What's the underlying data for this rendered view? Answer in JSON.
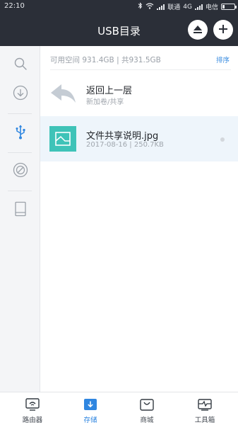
{
  "statusbar": {
    "time": "22:10",
    "carrier1": "联通",
    "network": "4G",
    "carrier2": "电信",
    "icons": [
      "bluetooth-icon",
      "wifi-icon",
      "signal-icon",
      "battery-icon"
    ]
  },
  "header": {
    "title": "USB目录",
    "eject_icon": "eject-icon",
    "add_icon": "plus-icon"
  },
  "sidebar": {
    "items": [
      {
        "icon": "search-icon"
      },
      {
        "icon": "download-icon"
      },
      {
        "icon": "usb-icon",
        "active": true
      },
      {
        "icon": "disk-icon"
      },
      {
        "icon": "tablet-icon"
      }
    ],
    "active_color": "#2f86e0"
  },
  "storage": {
    "space": "可用空间 931.4GB | 共931.5GB",
    "sort_label": "排序"
  },
  "list": {
    "back": {
      "name": "返回上一层",
      "sub": "新加卷/共享"
    },
    "files": [
      {
        "name": "文件共享说明.jpg",
        "meta": "2017-08-16 | 250.7KB",
        "thumb_color": "#3fc3b8"
      }
    ]
  },
  "bottomnav": {
    "items": [
      {
        "label": "路由器",
        "icon": "router-icon"
      },
      {
        "label": "存储",
        "icon": "storage-icon",
        "active": true
      },
      {
        "label": "商城",
        "icon": "shop-bag-icon"
      },
      {
        "label": "工具箱",
        "icon": "toolbox-icon"
      }
    ]
  }
}
